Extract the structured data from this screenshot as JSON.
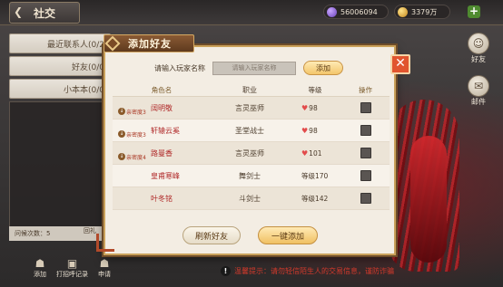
{
  "header": {
    "title": "社交",
    "currencies": [
      {
        "name": "diamond-icon",
        "value": "56006094"
      },
      {
        "name": "gold-coin-icon",
        "value": "3379万"
      }
    ],
    "plus_label": "+"
  },
  "left_tabs": [
    {
      "label": "最近联系人(0/2"
    },
    {
      "label": "好友(0/0"
    },
    {
      "label": "小本本(0/0"
    }
  ],
  "left_bottom": {
    "asked_count": "问候次数：5",
    "fragment": "回礼"
  },
  "bottom_actions": [
    {
      "icon": "add-friend-icon",
      "label": "添加"
    },
    {
      "icon": "gift-icon",
      "label": "打招呼记录"
    },
    {
      "icon": "apply-icon",
      "label": "申请"
    }
  ],
  "warning": {
    "icon": "!",
    "text": "温馨提示：请勿轻信陌生人的交易信息，谨防诈骗"
  },
  "side_nav": [
    {
      "icon": "friend-avatar-icon",
      "label": "好友"
    },
    {
      "icon": "mail-icon",
      "label": "邮件"
    }
  ],
  "dialog": {
    "title": "添加好友",
    "close_label": "✕",
    "search": {
      "label": "请输入玩家名称",
      "placeholder": "请输入玩家名称",
      "value": "",
      "button": "添加"
    },
    "columns": [
      "角色名",
      "职业",
      "等级",
      "操作"
    ],
    "rows": [
      {
        "tag": "亲密度3",
        "name": "阔明敬",
        "job": "言灵巫师",
        "level": "98",
        "level_icon": "heart"
      },
      {
        "tag": "亲密度3",
        "name": "轩辕云奚",
        "job": "圣堂战士",
        "level": "98",
        "level_icon": "heart"
      },
      {
        "tag": "亲密度4",
        "name": "路曼香",
        "job": "言灵巫师",
        "level": "101",
        "level_icon": "heart"
      },
      {
        "tag": "",
        "name": "皇甫寒峰",
        "job": "舞剑士",
        "level": "等级170",
        "level_icon": ""
      },
      {
        "tag": "",
        "name": "叶冬铭",
        "job": "斗剑士",
        "level": "等级142",
        "level_icon": ""
      }
    ],
    "refresh_button": "刷新好友",
    "add_all_button": "一键添加"
  },
  "colors": {
    "dialog_bg": "#f3ede3",
    "accent_gold": "#f0c063",
    "name_red": "#b02a2a",
    "close_orange": "#e1552e"
  }
}
